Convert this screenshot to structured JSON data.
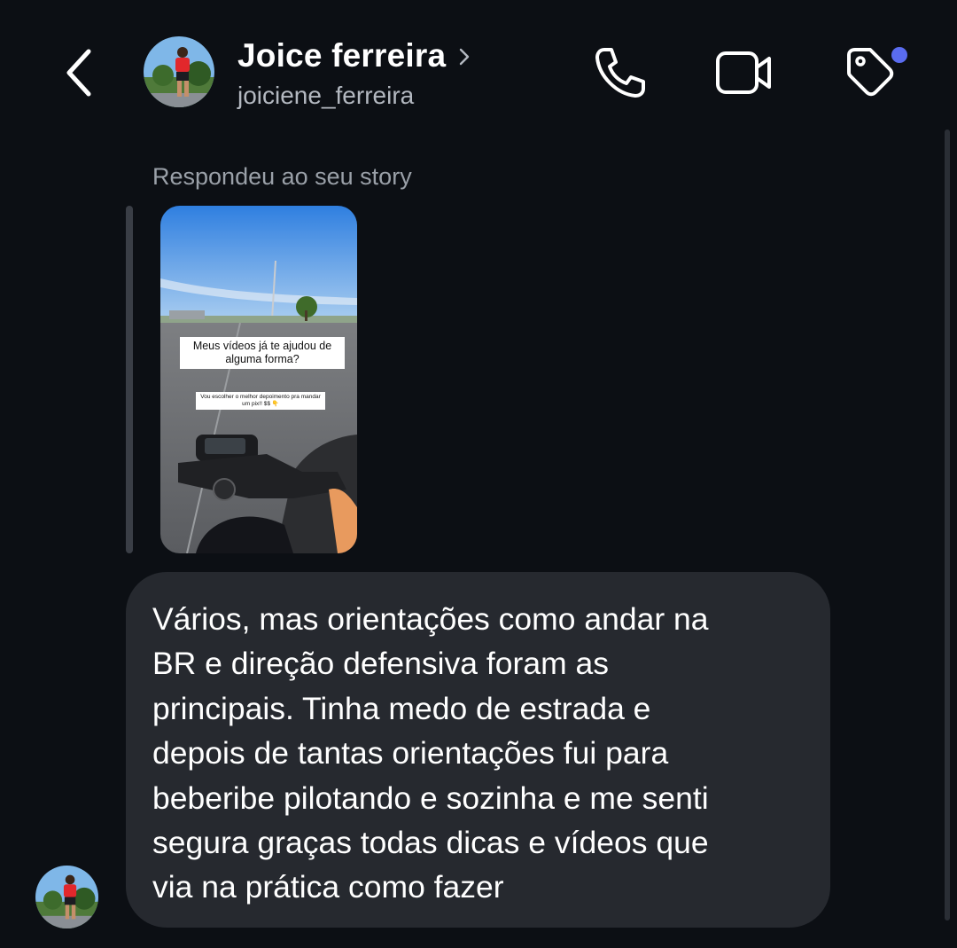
{
  "header": {
    "name": "Joice ferreira",
    "username": "joiciene_ferreira",
    "back_icon": "chevron-left-icon",
    "name_chevron_icon": "chevron-right-icon",
    "call_icon": "phone-icon",
    "video_icon": "video-camera-icon",
    "tag_icon": "tag-icon",
    "tag_dot_color": "#5a6cf0"
  },
  "conversation": {
    "story_reply_label": "Respondeu ao seu story",
    "story": {
      "caption": "Meus vídeos já te ajudou de alguma forma?",
      "sticker": "Vou escolher o melhor depoimento pra mandar um pix!! $$ 👇"
    },
    "message": {
      "lines": [
        "Vários, mas orientações como andar na",
        "BR e direção defensiva foram as",
        "principais. Tinha medo de estrada e",
        "depois de tantas orientações fui para",
        "beberibe pilotando e sozinha e me senti",
        "segura graças todas dicas e vídeos que",
        "via na prática como fazer"
      ]
    }
  },
  "colors": {
    "background": "#0c0f14",
    "bubble": "#26292f",
    "secondary_text": "#b3b8c0",
    "label_text": "#9aa0a8"
  }
}
